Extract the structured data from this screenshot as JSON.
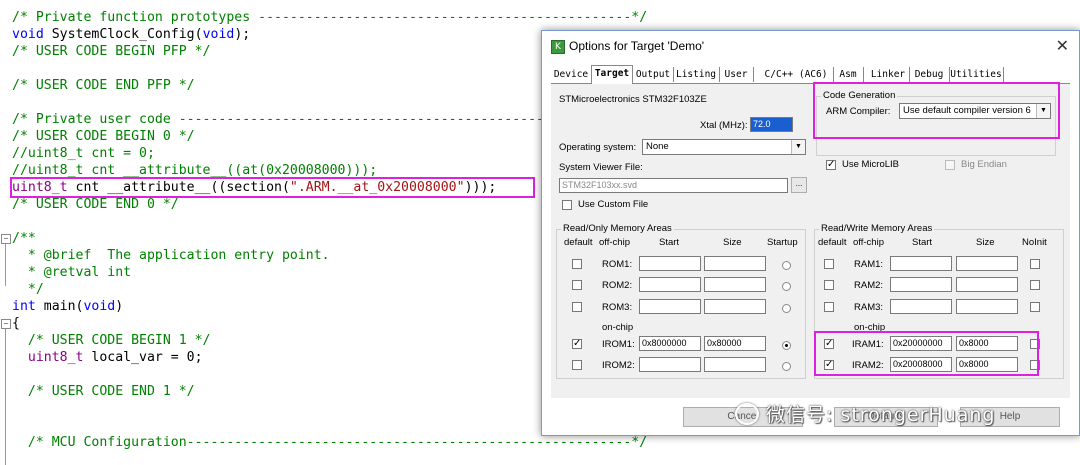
{
  "editor": {
    "lines": [
      "/* Private function prototypes -----------------------------------------------*/",
      "void SystemClock_Config(void);",
      "/* USER CODE BEGIN PFP */",
      "",
      "/* USER CODE END PFP */",
      "",
      "/* Private user code -----------------------------------------------------------",
      "/* USER CODE BEGIN 0 */",
      "//uint8_t cnt = 0;",
      "//uint8_t cnt __attribute__((at(0x20008000)));",
      "uint8_t cnt __attribute__((section(\".ARM.__at_0x20008000\")));",
      "/* USER CODE END 0 */",
      "",
      "/**",
      "  * @brief  The application entry point.",
      "  * @retval int",
      "  */",
      "int main(void)",
      "{",
      "  /* USER CODE BEGIN 1 */",
      "  uint8_t local_var = 0;",
      "",
      "  /* USER CODE END 1 */",
      "",
      "",
      "  /* MCU Configuration--------------------------------------------------------*/"
    ]
  },
  "dialog": {
    "title": "Options for Target 'Demo'",
    "close_glyph": "✕",
    "tabs": [
      "Device",
      "Target",
      "Output",
      "Listing",
      "User",
      "C/C++ (AC6)",
      "Asm",
      "Linker",
      "Debug",
      "Utilities"
    ],
    "active_tab": "Target",
    "device_name": "STMicroelectronics STM32F103ZE",
    "xtal_label": "Xtal (MHz):",
    "xtal_value": "72.0",
    "os_label": "Operating system:",
    "os_value": "None",
    "svf_label": "System Viewer File:",
    "svf_value": "STM32F103xx.svd",
    "browse_label": "...",
    "use_custom_file_label": "Use Custom File",
    "code_generation": {
      "group_label": "Code Generation",
      "compiler_label": "ARM Compiler:",
      "compiler_value": "Use default compiler version 6",
      "use_microlib_label": "Use MicroLIB",
      "use_microlib_checked": true,
      "big_endian_label": "Big Endian",
      "big_endian_checked": false
    },
    "ro_memory": {
      "group_label": "Read/Only Memory Areas",
      "headers": [
        "default",
        "off-chip",
        "Start",
        "Size",
        "Startup"
      ],
      "on_chip_label": "on-chip",
      "rows": [
        {
          "name": "ROM1:",
          "default": false,
          "start": "",
          "size": "",
          "startup": false
        },
        {
          "name": "ROM2:",
          "default": false,
          "start": "",
          "size": "",
          "startup": false
        },
        {
          "name": "ROM3:",
          "default": false,
          "start": "",
          "size": "",
          "startup": false
        },
        {
          "name": "IROM1:",
          "default": true,
          "start": "0x8000000",
          "size": "0x80000",
          "startup": true
        },
        {
          "name": "IROM2:",
          "default": false,
          "start": "",
          "size": "",
          "startup": false
        }
      ]
    },
    "rw_memory": {
      "group_label": "Read/Write Memory Areas",
      "headers": [
        "default",
        "off-chip",
        "Start",
        "Size",
        "NoInit"
      ],
      "on_chip_label": "on-chip",
      "rows": [
        {
          "name": "RAM1:",
          "default": false,
          "start": "",
          "size": "",
          "noinit": false
        },
        {
          "name": "RAM2:",
          "default": false,
          "start": "",
          "size": "",
          "noinit": false
        },
        {
          "name": "RAM3:",
          "default": false,
          "start": "",
          "size": "",
          "noinit": false
        },
        {
          "name": "IRAM1:",
          "default": true,
          "start": "0x20000000",
          "size": "0x8000",
          "noinit": false
        },
        {
          "name": "IRAM2:",
          "default": true,
          "start": "0x20008000",
          "size": "0x8000",
          "noinit": false
        }
      ]
    },
    "buttons": {
      "cancel_label": "Cancel",
      "defaults_label": "Defaults",
      "help_label": "Help"
    }
  },
  "watermark": {
    "text": "微信号: strongerHuang"
  },
  "colors": {
    "highlight": "#e020e0",
    "comment": "#008000",
    "keyword": "#0000ff",
    "type": "#8b008b",
    "string": "#a31515",
    "selection": "#1a5fd0"
  }
}
